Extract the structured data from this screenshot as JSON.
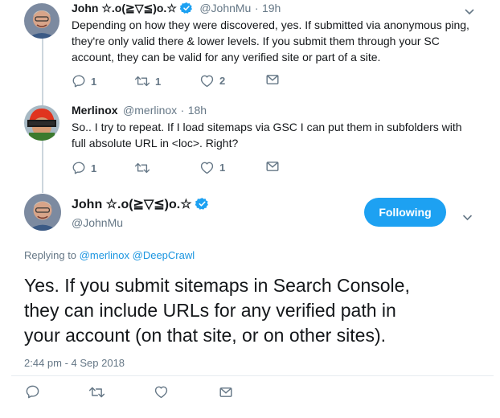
{
  "tweets": [
    {
      "name": "John ☆.o(≧▽≦)o.☆",
      "handle": "@JohnMu",
      "sep": "·",
      "time": "19h",
      "text_lines": [
        "Depending on how they were discovered, yes. If submitted via anonymous ping,",
        "they're only valid there & lower levels. If you submit them through your SC",
        "account, they can be valid for any verified site or part of a site."
      ],
      "reply_count": "1",
      "retweet_count": "1",
      "like_count": "2"
    },
    {
      "name": "Merlinox",
      "handle": "@merlinox",
      "sep": "·",
      "time": "18h",
      "text_lines": [
        "So.. I try to repeat. If I load sitemaps via GSC I can put them in subfolders with",
        "full absolute URL in <loc>. Right?"
      ],
      "reply_count": "1",
      "retweet_count": "",
      "like_count": "1"
    }
  ],
  "main": {
    "name": "John ☆.o(≧▽≦)o.☆",
    "handle": "@JohnMu",
    "follow_label": "Following",
    "replying_prefix": "Replying to",
    "mention_1": "@merlinox",
    "mention_2": "@DeepCrawl",
    "text_lines": [
      "Yes. If you submit sitemaps in Search Console,",
      "they can include URLs for any verified path in",
      "your account (on that site, or on other sites)."
    ],
    "timestamp": "2:44 pm - 4 Sep 2018"
  },
  "colors": {
    "accent": "#1da1f2",
    "link": "#1b95e0",
    "muted": "#657786",
    "thread_line": "#ccd6dd"
  },
  "icons": [
    "reply-icon",
    "retweet-icon",
    "like-icon",
    "dm-icon",
    "verified-icon",
    "chevron-down-icon"
  ]
}
